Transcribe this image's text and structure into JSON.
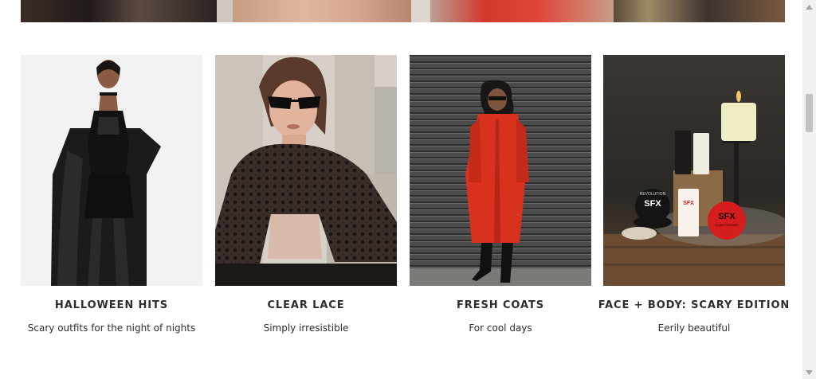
{
  "tiles": [
    {
      "title": "HALLOWEEN HITS",
      "subtitle": "Scary outfits for the night of nights"
    },
    {
      "title": "CLEAR LACE",
      "subtitle": "Simply irresistible"
    },
    {
      "title": "FRESH COATS",
      "subtitle": "For cool days"
    },
    {
      "title": "FACE + BODY: SCARY EDITION",
      "subtitle": "Eerily beautiful"
    }
  ],
  "products": {
    "pot_brand": "REVOLUTION",
    "pot_label": "SFX",
    "red_pot_label": "SFX",
    "red_pot_sub": "SCAB POWDER",
    "tube_label": "SFX"
  }
}
